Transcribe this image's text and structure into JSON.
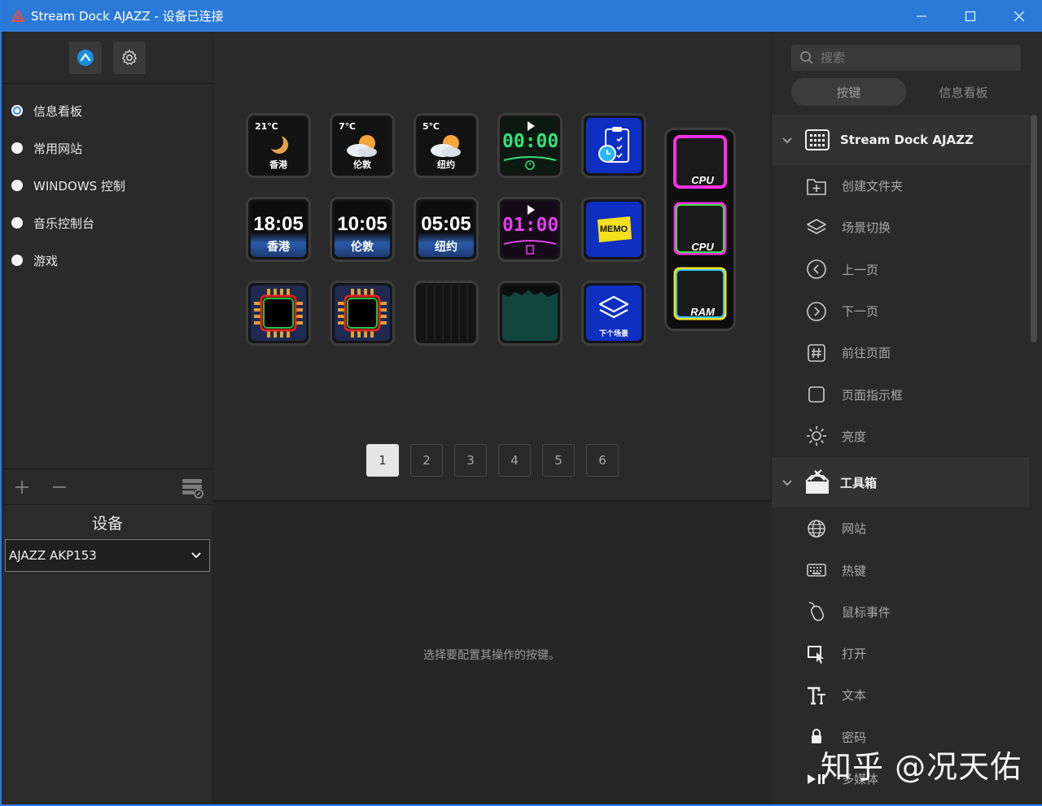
{
  "window": {
    "title": "Stream Dock AJAZZ - 设备已连接",
    "controls": [
      "minimize-icon",
      "maximize-icon",
      "close-icon"
    ]
  },
  "left": {
    "top_icons": [
      "app-icon",
      "gear-icon"
    ],
    "profiles": [
      {
        "label": "信息看板",
        "selected": true
      },
      {
        "label": "常用网站",
        "selected": false
      },
      {
        "label": "WINDOWS 控制",
        "selected": false
      },
      {
        "label": "音乐控制台",
        "selected": false
      },
      {
        "label": "游戏",
        "selected": false
      }
    ],
    "bottom_icons": [
      "plus-icon",
      "minus-icon",
      "profile-export-icon"
    ],
    "device_title": "设备",
    "device_selected": "AJAZZ AKP153"
  },
  "keys": {
    "weather": [
      {
        "temp": "21℃",
        "city": "香港"
      },
      {
        "temp": "7℃",
        "city": "伦敦"
      },
      {
        "temp": "5℃",
        "city": "纽约"
      }
    ],
    "timers": [
      {
        "time": "00:00",
        "color": "#34e07a"
      },
      {
        "time": "01:00",
        "color": "#e040e8"
      }
    ],
    "clocks": [
      {
        "time": "18:05",
        "city": "香港"
      },
      {
        "time": "10:05",
        "city": "伦敦"
      },
      {
        "time": "05:05",
        "city": "纽约"
      }
    ],
    "memo_label": "MEMO",
    "next_scene_label": "下个场景",
    "tall_labels": [
      "CPU",
      "CPU",
      "RAM"
    ]
  },
  "pagination": {
    "pages": [
      "1",
      "2",
      "3",
      "4",
      "5",
      "6"
    ],
    "current": "1"
  },
  "hint": "选择要配置其操作的按键。",
  "right": {
    "search_placeholder": "搜索",
    "tabs": [
      {
        "label": "按键",
        "active": true
      },
      {
        "label": "信息看板",
        "active": false
      }
    ],
    "group1": {
      "label": "Stream Dock AJAZZ",
      "actions": [
        "创建文件夹",
        "场景切换",
        "上一页",
        "下一页",
        "前往页面",
        "页面指示框",
        "亮度"
      ]
    },
    "group2": {
      "label": "工具箱",
      "actions": [
        "网站",
        "热键",
        "鼠标事件",
        "打开",
        "文本",
        "密码",
        "多媒体"
      ]
    }
  },
  "watermark": "知乎 @况天佑",
  "colors": {
    "titlebar": "#2b7ad8",
    "accent": "#2d8cf0",
    "key_blue": "#0f2fc2"
  }
}
